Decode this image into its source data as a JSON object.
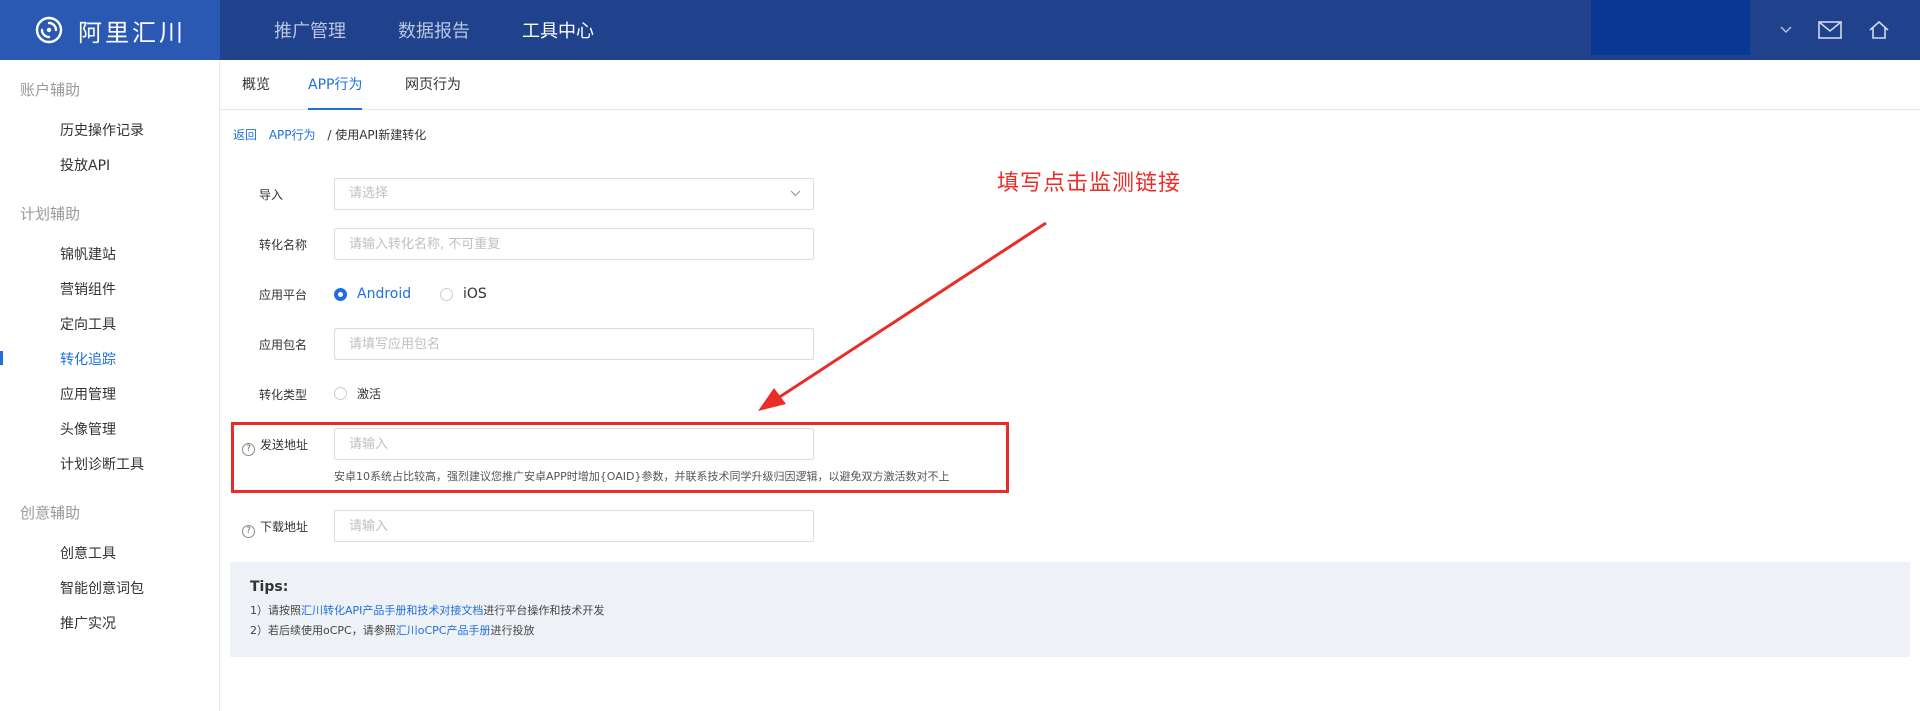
{
  "header": {
    "logo_text": "阿里汇川",
    "nav": [
      {
        "label": "推广管理",
        "active": false
      },
      {
        "label": "数据报告",
        "active": false
      },
      {
        "label": "工具中心",
        "active": true
      }
    ]
  },
  "sidebar": {
    "groups": [
      {
        "title": "账户辅助",
        "items": [
          "历史操作记录",
          "投放API"
        ]
      },
      {
        "title": "计划辅助",
        "items": [
          "锦帆建站",
          "营销组件",
          "定向工具",
          "转化追踪",
          "应用管理",
          "头像管理",
          "计划诊断工具"
        ]
      },
      {
        "title": "创意辅助",
        "items": [
          "创意工具",
          "智能创意词包",
          "推广实况"
        ]
      }
    ],
    "active_item": "转化追踪"
  },
  "tabs": [
    {
      "label": "概览",
      "active": false
    },
    {
      "label": "APP行为",
      "active": true
    },
    {
      "label": "网页行为",
      "active": false
    }
  ],
  "breadcrumb": {
    "back": "返回",
    "parent": "APP行为",
    "current": "/ 使用API新建转化"
  },
  "form": {
    "import_label": "导入",
    "import_placeholder": "请选择",
    "name_label": "转化名称",
    "name_placeholder": "请输入转化名称, 不可重复",
    "platform_label": "应用平台",
    "platform_options": [
      "Android",
      "iOS"
    ],
    "platform_selected": "Android",
    "package_label": "应用包名",
    "package_placeholder": "请填写应用包名",
    "type_label": "转化类型",
    "type_option": "激活",
    "send_label": "发送地址",
    "send_placeholder": "请输入",
    "send_hint": "安卓10系统占比较高，强烈建议您推广安卓APP时增加{OAID}参数，并联系技术同学升级归因逻辑，以避免双方激活数对不上",
    "download_label": "下载地址",
    "download_placeholder": "请输入"
  },
  "annotation": {
    "text": "填写点击监测链接",
    "color": "#e92e2a"
  },
  "tips": {
    "title": "Tips:",
    "line1_prefix": "1）请按照",
    "line1_link": "汇川转化API产品手册和技术对接文档",
    "line1_suffix": "进行平台操作和技术开发",
    "line2_prefix": "2）若后续使用oCPC，请参照",
    "line2_link": "汇川oCPC产品手册",
    "line2_suffix": "进行投放"
  },
  "colors": {
    "header_bg": "#20428d",
    "logo_bg": "#2a59b3",
    "accent": "#1f6fe0"
  }
}
